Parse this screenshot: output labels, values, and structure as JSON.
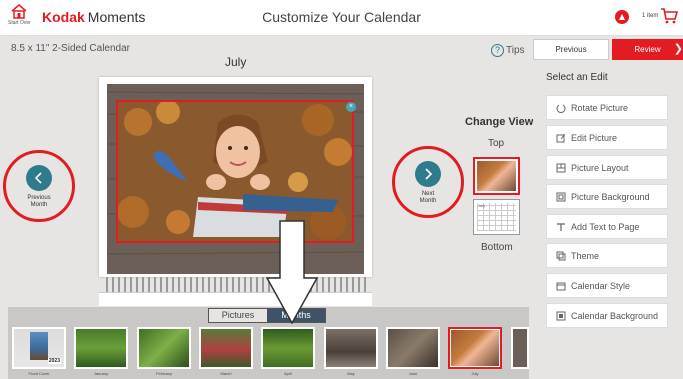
{
  "header": {
    "start_over": "Start Over",
    "brand_kodak": "Kodak",
    "brand_moments": "Moments",
    "title": "Customize Your Calendar",
    "cart_count": "1 item"
  },
  "product": {
    "name": "8.5 x 11\" 2-Sided Calendar",
    "month": "July"
  },
  "tips_label": "Tips",
  "nav": {
    "previous_month": [
      "Previous",
      "Month"
    ],
    "next_month": [
      "Next",
      "Month"
    ]
  },
  "change_view": {
    "title": "Change View",
    "top": "Top",
    "bottom": "Bottom",
    "thumb_month": "July"
  },
  "actions": {
    "previous": "Previous",
    "review": "Review"
  },
  "edit_panel": {
    "title": "Select an Edit",
    "items": [
      {
        "label": "Rotate Picture",
        "icon": "rotate-icon"
      },
      {
        "label": "Edit Picture",
        "icon": "edit-icon"
      },
      {
        "label": "Picture Layout",
        "icon": "layout-icon"
      },
      {
        "label": "Picture Background",
        "icon": "background-icon"
      },
      {
        "label": "Add Text to Page",
        "icon": "text-icon"
      },
      {
        "label": "Theme",
        "icon": "theme-icon"
      },
      {
        "label": "Calendar Style",
        "icon": "calendar-style-icon"
      },
      {
        "label": "Calendar Background",
        "icon": "calendar-background-icon"
      }
    ]
  },
  "toggle": {
    "pictures": "Pictures",
    "months": "Months"
  },
  "months_strip": [
    {
      "label": "Front Cover",
      "year": "2023"
    },
    {
      "label": "January"
    },
    {
      "label": "February"
    },
    {
      "label": "March"
    },
    {
      "label": "April"
    },
    {
      "label": "May"
    },
    {
      "label": "June"
    },
    {
      "label": "July",
      "active": true
    }
  ],
  "colors": {
    "brand_red": "#e31b23",
    "teal": "#2f7b8c",
    "toggle_active": "#3e5367"
  }
}
